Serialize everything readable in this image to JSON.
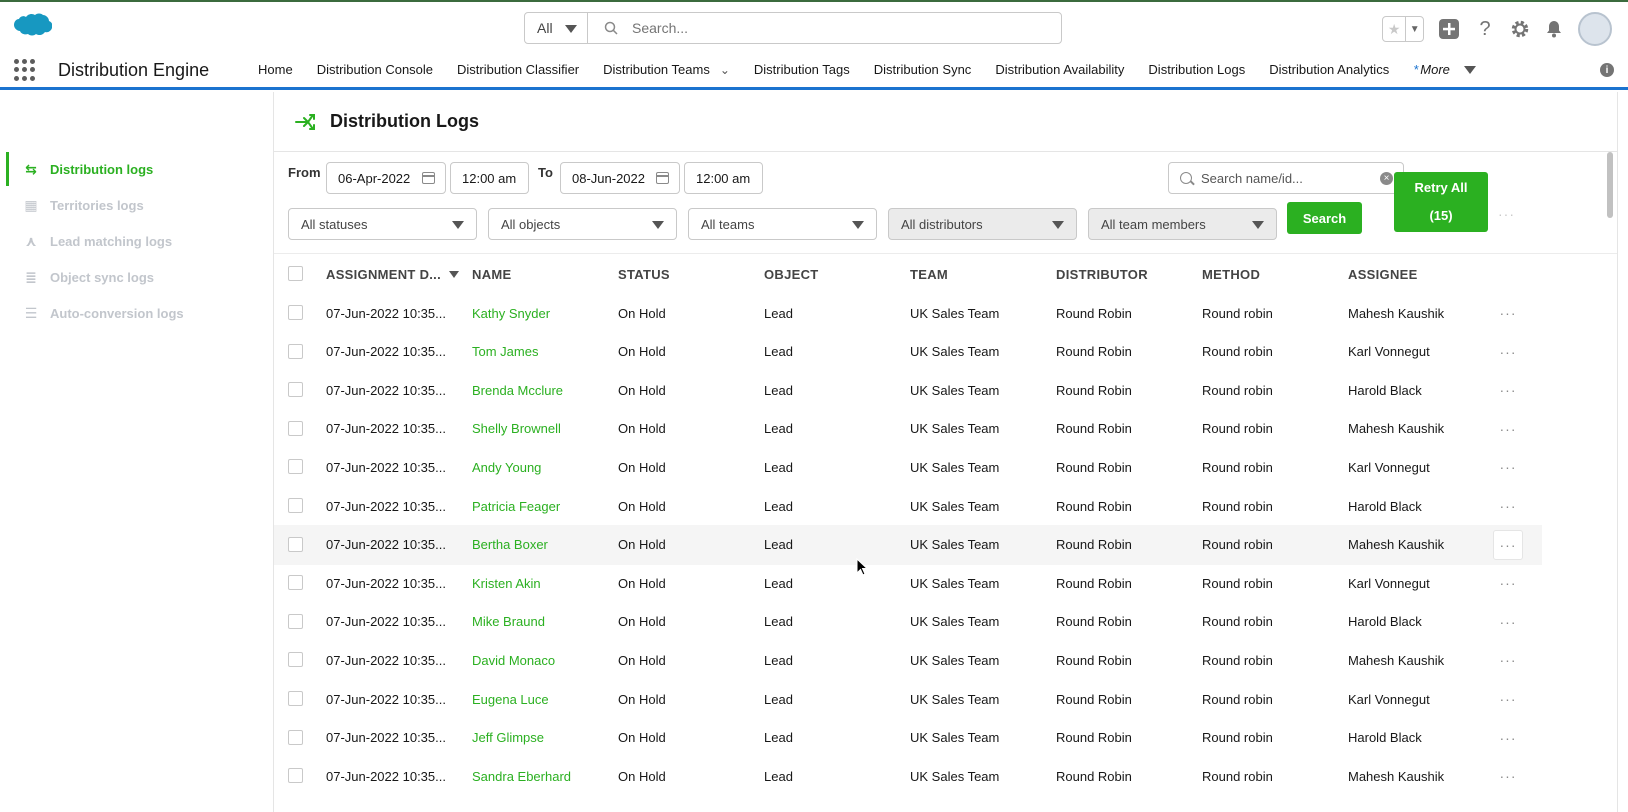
{
  "topbar": {
    "search_scope": "All",
    "search_placeholder": "Search..."
  },
  "nav": {
    "app_name": "Distribution Engine",
    "items": [
      {
        "label": "Home",
        "dropdown": false
      },
      {
        "label": "Distribution Console",
        "dropdown": false
      },
      {
        "label": "Distribution Classifier",
        "dropdown": false
      },
      {
        "label": "Distribution Teams",
        "dropdown": true
      },
      {
        "label": "Distribution Tags",
        "dropdown": false
      },
      {
        "label": "Distribution Sync",
        "dropdown": false
      },
      {
        "label": "Distribution Availability",
        "dropdown": false
      },
      {
        "label": "Distribution Logs",
        "dropdown": false
      },
      {
        "label": "Distribution Analytics",
        "dropdown": false
      }
    ],
    "more_star": "*",
    "more_label": "More"
  },
  "sidebar": {
    "items": [
      {
        "label": "Distribution logs",
        "active": true,
        "icon": "distribution-icon"
      },
      {
        "label": "Territories logs",
        "active": false,
        "icon": "map-icon"
      },
      {
        "label": "Lead matching logs",
        "active": false,
        "icon": "merge-icon"
      },
      {
        "label": "Object sync logs",
        "active": false,
        "icon": "database-sync-icon"
      },
      {
        "label": "Auto-conversion logs",
        "active": false,
        "icon": "conversion-icon"
      }
    ]
  },
  "page": {
    "title": "Distribution Logs"
  },
  "filters": {
    "from_label": "From",
    "from_date": "06-Apr-2022",
    "from_time": "12:00 am",
    "to_label": "To",
    "to_date": "08-Jun-2022",
    "to_time": "12:00 am",
    "name_search_placeholder": "Search name/id...",
    "statuses": "All statuses",
    "objects": "All objects",
    "teams": "All teams",
    "distributors": "All distributors",
    "team_members": "All team members",
    "search_button": "Search",
    "retry_label": "Retry All",
    "retry_count": "(15)",
    "overflow": "···"
  },
  "table": {
    "columns": [
      "ASSIGNMENT D...",
      "NAME",
      "STATUS",
      "OBJECT",
      "TEAM",
      "DISTRIBUTOR",
      "METHOD",
      "ASSIGNEE"
    ],
    "row_menu": "···",
    "rows": [
      [
        "07-Jun-2022 10:35...",
        "Kathy Snyder",
        "On Hold",
        "Lead",
        "UK Sales Team",
        "Round Robin",
        "Round robin",
        "Mahesh Kaushik"
      ],
      [
        "07-Jun-2022 10:35...",
        "Tom James",
        "On Hold",
        "Lead",
        "UK Sales Team",
        "Round Robin",
        "Round robin",
        "Karl Vonnegut"
      ],
      [
        "07-Jun-2022 10:35...",
        "Brenda Mcclure",
        "On Hold",
        "Lead",
        "UK Sales Team",
        "Round Robin",
        "Round robin",
        "Harold Black"
      ],
      [
        "07-Jun-2022 10:35...",
        "Shelly Brownell",
        "On Hold",
        "Lead",
        "UK Sales Team",
        "Round Robin",
        "Round robin",
        "Mahesh Kaushik"
      ],
      [
        "07-Jun-2022 10:35...",
        "Andy Young",
        "On Hold",
        "Lead",
        "UK Sales Team",
        "Round Robin",
        "Round robin",
        "Karl Vonnegut"
      ],
      [
        "07-Jun-2022 10:35...",
        "Patricia Feager",
        "On Hold",
        "Lead",
        "UK Sales Team",
        "Round Robin",
        "Round robin",
        "Harold Black"
      ],
      [
        "07-Jun-2022 10:35...",
        "Bertha Boxer",
        "On Hold",
        "Lead",
        "UK Sales Team",
        "Round Robin",
        "Round robin",
        "Mahesh Kaushik"
      ],
      [
        "07-Jun-2022 10:35...",
        "Kristen Akin",
        "On Hold",
        "Lead",
        "UK Sales Team",
        "Round Robin",
        "Round robin",
        "Karl Vonnegut"
      ],
      [
        "07-Jun-2022 10:35...",
        "Mike Braund",
        "On Hold",
        "Lead",
        "UK Sales Team",
        "Round Robin",
        "Round robin",
        "Harold Black"
      ],
      [
        "07-Jun-2022 10:35...",
        "David Monaco",
        "On Hold",
        "Lead",
        "UK Sales Team",
        "Round Robin",
        "Round robin",
        "Mahesh Kaushik"
      ],
      [
        "07-Jun-2022 10:35...",
        "Eugena Luce",
        "On Hold",
        "Lead",
        "UK Sales Team",
        "Round Robin",
        "Round robin",
        "Karl Vonnegut"
      ],
      [
        "07-Jun-2022 10:35...",
        "Jeff Glimpse",
        "On Hold",
        "Lead",
        "UK Sales Team",
        "Round Robin",
        "Round robin",
        "Harold Black"
      ],
      [
        "07-Jun-2022 10:35...",
        "Sandra Eberhard",
        "On Hold",
        "Lead",
        "UK Sales Team",
        "Round Robin",
        "Round robin",
        "Mahesh Kaushik"
      ]
    ],
    "hover_row": 6
  },
  "colors": {
    "accent_green": "#2bb021",
    "nav_underline": "#1b73cf",
    "salesforce_blue": "#1798c1"
  }
}
